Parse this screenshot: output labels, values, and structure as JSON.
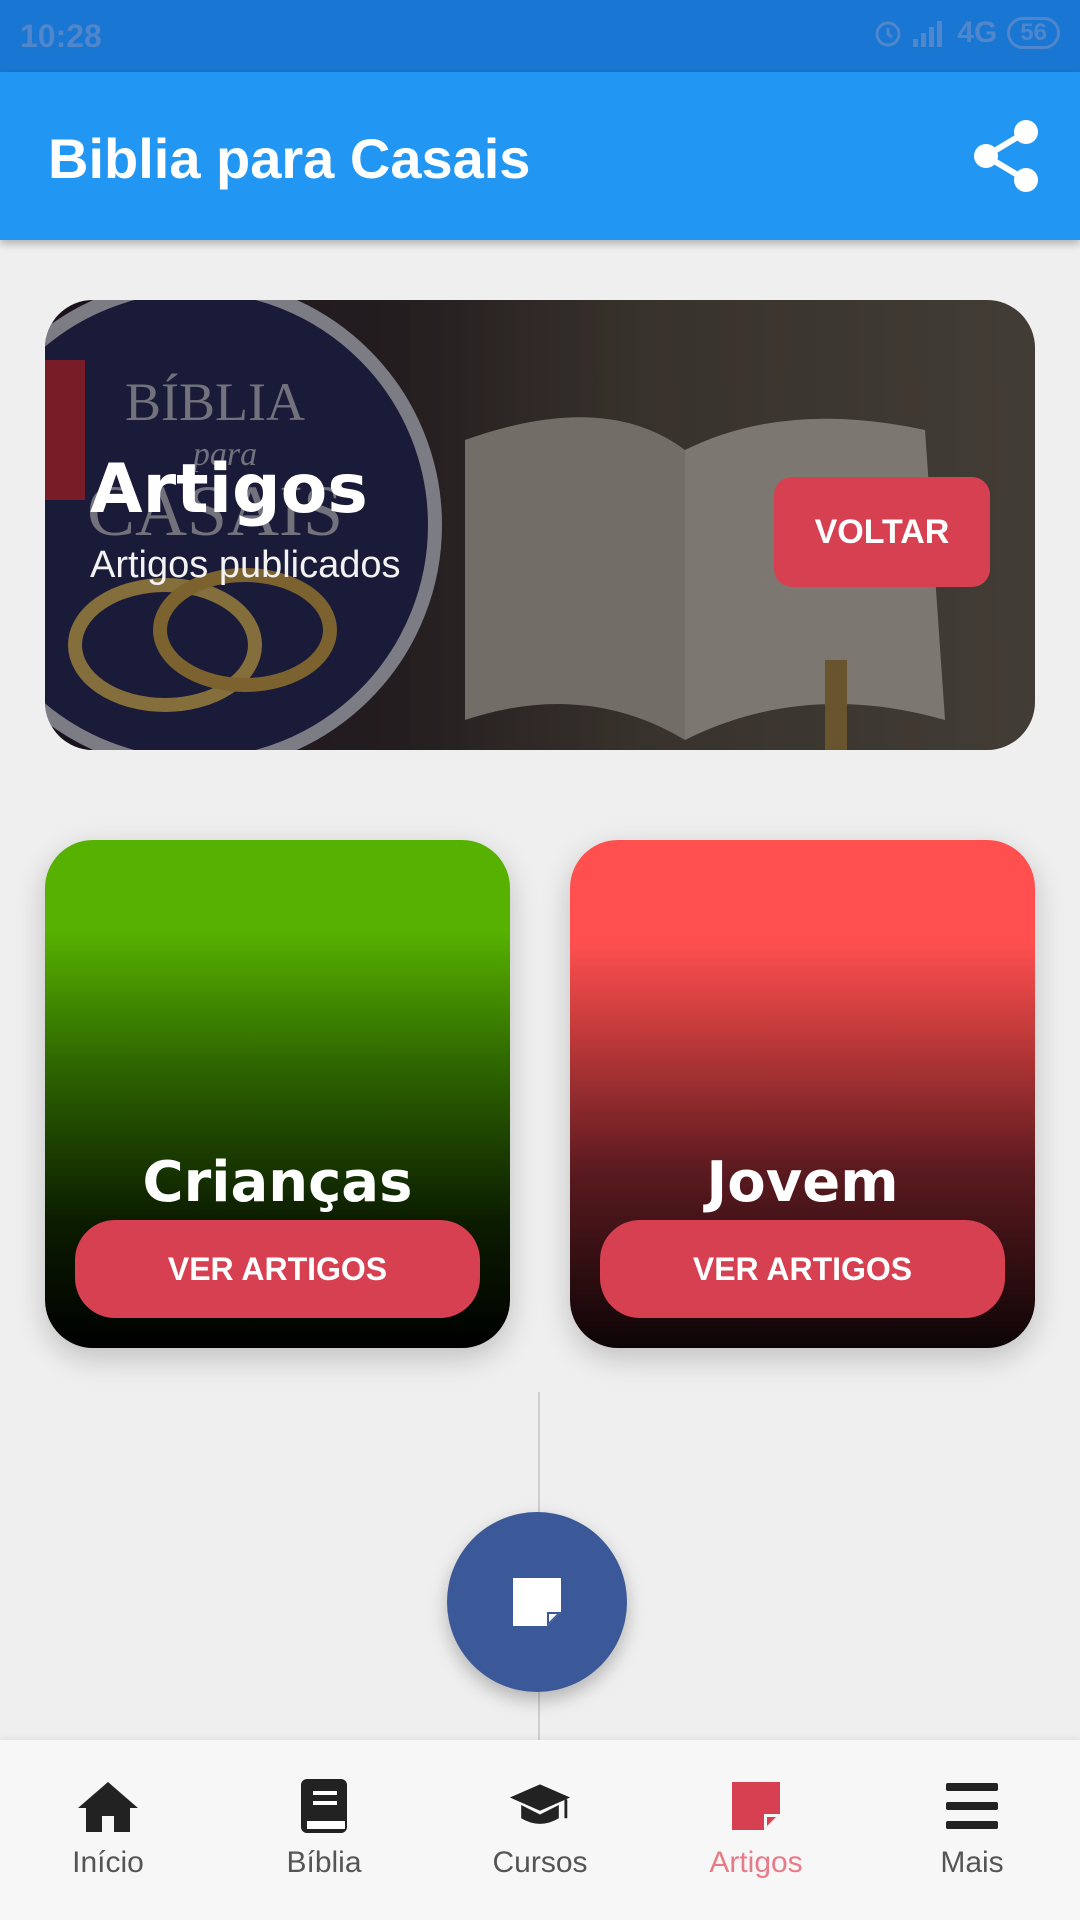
{
  "status_bar": {
    "time": "10:28",
    "network": "4G",
    "battery": "56"
  },
  "app_bar": {
    "title": "Biblia para Casais",
    "share_icon": "share-icon"
  },
  "hero": {
    "title": "Artigos",
    "subtitle": "Artigos publicados",
    "button_label": "VOLTAR",
    "logo_text": [
      "BÍBLIA",
      "para",
      "CASAIS"
    ]
  },
  "categories": [
    {
      "title": "Crianças",
      "button_label": "VER ARTIGOS",
      "color": "#57b100"
    },
    {
      "title": "Jovem",
      "button_label": "VER ARTIGOS",
      "color": "#ff4f4f"
    }
  ],
  "fab": {
    "icon": "note-icon",
    "color": "#3b5998"
  },
  "bottom_nav": {
    "items": [
      {
        "label": "Início",
        "icon": "home-icon"
      },
      {
        "label": "Bíblia",
        "icon": "book-icon"
      },
      {
        "label": "Cursos",
        "icon": "graduation-cap-icon"
      },
      {
        "label": "Artigos",
        "icon": "note-icon",
        "active": true
      },
      {
        "label": "Mais",
        "icon": "menu-icon"
      }
    ]
  },
  "colors": {
    "primary": "#2196f3",
    "accent": "#d64050",
    "active_nav": "#e87b88"
  }
}
